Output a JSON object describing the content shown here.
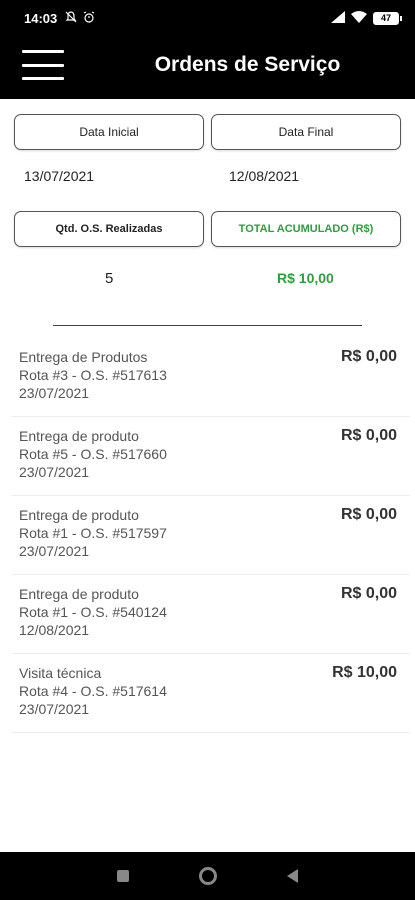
{
  "status_bar": {
    "time": "14:03",
    "battery": "47",
    "icons": [
      "notifications-off-icon",
      "alarm-icon",
      "signal-icon",
      "wifi-icon",
      "battery-icon"
    ]
  },
  "app_bar": {
    "title": "Ordens de Serviço",
    "menu_icon": "menu-icon"
  },
  "filters": {
    "start_date_label": "Data Inicial",
    "end_date_label": "Data Final",
    "start_date_value": "13/07/2021",
    "end_date_value": "12/08/2021",
    "count_label": "Qtd. O.S. Realizadas",
    "total_label": "TOTAL ACUMULADO (R$)",
    "count_value": "5",
    "total_value": "R$ 10,00"
  },
  "orders": [
    {
      "title": "Entrega de Produtos",
      "route": "Rota #3 - O.S. #517613",
      "date": "23/07/2021",
      "amount": "R$ 0,00"
    },
    {
      "title": "Entrega de produto",
      "route": "Rota #5 - O.S. #517660",
      "date": "23/07/2021",
      "amount": "R$ 0,00"
    },
    {
      "title": "Entrega de produto",
      "route": "Rota #1 - O.S. #517597",
      "date": "23/07/2021",
      "amount": "R$ 0,00"
    },
    {
      "title": "Entrega de produto",
      "route": "Rota #1 - O.S. #540124",
      "date": "12/08/2021",
      "amount": "R$ 0,00"
    },
    {
      "title": "Visita técnica",
      "route": "Rota #4 - O.S. #517614",
      "date": "23/07/2021",
      "amount": "R$ 10,00"
    }
  ],
  "colors": {
    "header_bg": "#000000",
    "accent_green": "#2e9e3e"
  }
}
